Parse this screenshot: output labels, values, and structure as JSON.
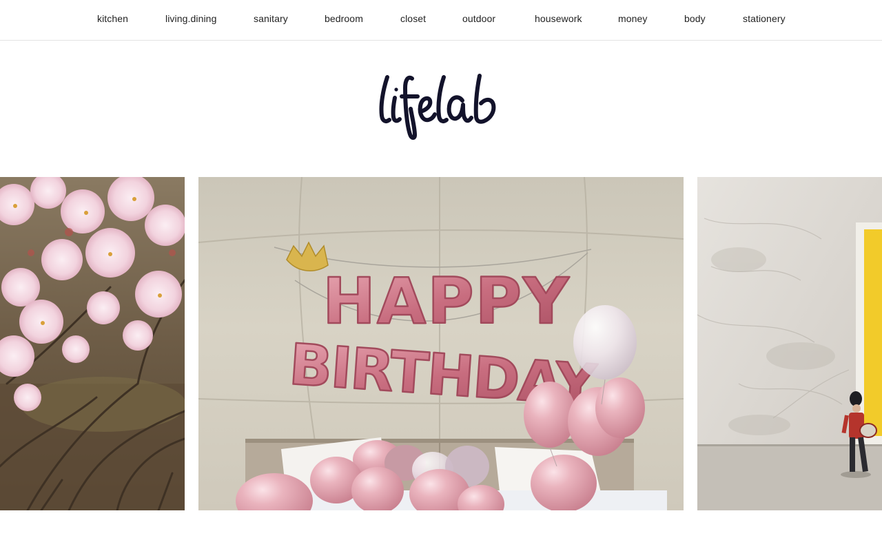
{
  "nav": {
    "items": [
      {
        "label": "kitchen"
      },
      {
        "label": "living.dining"
      },
      {
        "label": "sanitary"
      },
      {
        "label": "bedroom"
      },
      {
        "label": "closet"
      },
      {
        "label": "outdoor"
      },
      {
        "label": "housework"
      },
      {
        "label": "money"
      },
      {
        "label": "body"
      },
      {
        "label": "stationery"
      }
    ]
  },
  "brand": {
    "logo_text": "lifelab",
    "logo_color": "#13132b"
  },
  "slider": {
    "slides": [
      {
        "subject": "cherry blossoms"
      },
      {
        "subject": "birthday balloons",
        "banner_line1": "HAPPY",
        "banner_line2": "BIRTHDAY"
      },
      {
        "subject": "toy soldier drummer"
      }
    ]
  },
  "colors": {
    "nav_border": "#e3e3e3",
    "text": "#222222",
    "balloon_pink": "#e0a4ae",
    "tent_beige": "#d8d2c4"
  }
}
